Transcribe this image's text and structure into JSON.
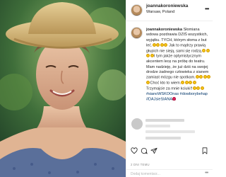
{
  "post": {
    "username": "joannakoroniewska",
    "location": "Warsaw, Poland",
    "more_glyph": "•••"
  },
  "caption": {
    "username": "joannakoroniewska",
    "lines": [
      {
        "text": "Słomiana",
        "emoji_before": 0,
        "emoji_after": 0
      },
      {
        "text": "wdowa pozdrawia DZIŚ wszystkich,",
        "emoji_after": 0
      },
      {
        "text": "wyjątku. TYCH, którym słoma z but",
        "emoji_after": 0
      },
      {
        "text": "leć.",
        "emoji_after": 4,
        "tail": " Jak to mądrzy prawią"
      },
      {
        "text": "głupich nie sieją, sami się rodzą.",
        "emoji_after": 2
      },
      {
        "text": "",
        "emoji_before": 2,
        "tail": "I tym jakże optymistycznym"
      },
      {
        "text": "akcentem lecę na próbę do teatru.",
        "emoji_after": 0
      },
      {
        "text": "Mam nadzieję, że już dziś na swojej",
        "emoji_after": 0
      },
      {
        "text": "drodze żadnego człowieka z sianem",
        "emoji_after": 0
      },
      {
        "text": "zamiast mózgu nie spotkam.",
        "emoji_after": 4
      },
      {
        "text": "Choć kto to wiem.",
        "emoji_before": 1,
        "emoji_after": 4
      },
      {
        "text": "Trzymajcie za mnie kciuki!!",
        "emoji_after": 3
      },
      {
        "text": "#sianoWSKOOnas #dowborybehap",
        "hashtag": true
      },
      {
        "text": "#DAJsieSIANA",
        "hashtag": true,
        "emoji_after": 1
      }
    ]
  },
  "stats": {
    "likes": "",
    "date": "2 DNI TEMU"
  },
  "comment": {
    "placeholder": "Dodaj komentarz...",
    "more_glyph": "•••"
  },
  "icons": [
    "heart-icon",
    "comment-icon",
    "share-icon",
    "bookmark-icon",
    "more-icon"
  ]
}
